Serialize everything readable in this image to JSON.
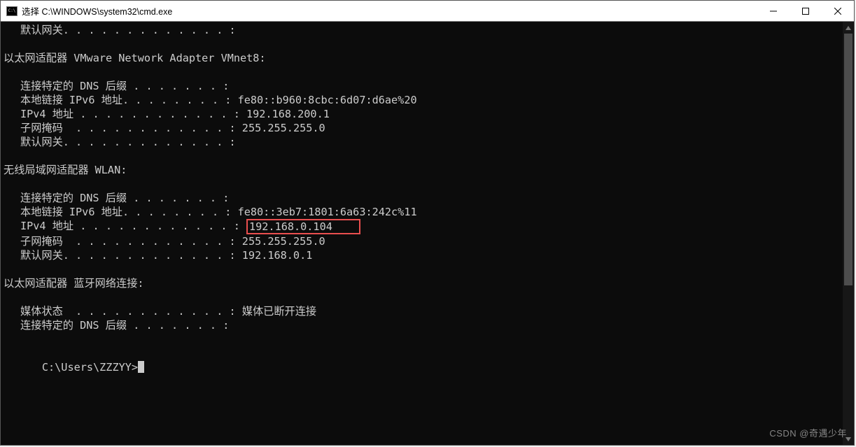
{
  "window": {
    "title": "选择 C:\\WINDOWS\\system32\\cmd.exe"
  },
  "term": {
    "top_line": {
      "label": "默认网关",
      "dots": ". . . . . . . . . . . . .",
      "sep": " : ",
      "val": ""
    },
    "adapter_vmnet8_header": "以太网适配器 VMware Network Adapter VMnet8:",
    "vmnet8": {
      "dns_suffix": {
        "label": "连接特定的 DNS 后缀 ",
        "dots": ". . . . . . .",
        "sep": " : ",
        "val": ""
      },
      "ipv6": {
        "label": "本地链接 IPv6 地址",
        "dots": ". . . . . . . .",
        "sep": " : ",
        "val": "fe80::b960:8cbc:6d07:d6ae%20"
      },
      "ipv4": {
        "label": "IPv4 地址 ",
        "dots": ". . . . . . . . . . . .",
        "sep": " : ",
        "val": "192.168.200.1"
      },
      "subnet": {
        "label": "子网掩码  ",
        "dots": ". . . . . . . . . . . .",
        "sep": " : ",
        "val": "255.255.255.0"
      },
      "gateway": {
        "label": "默认网关",
        "dots": ". . . . . . . . . . . . .",
        "sep": " : ",
        "val": ""
      }
    },
    "adapter_wlan_header": "无线局域网适配器 WLAN:",
    "wlan": {
      "dns_suffix": {
        "label": "连接特定的 DNS 后缀 ",
        "dots": ". . . . . . .",
        "sep": " : ",
        "val": ""
      },
      "ipv6": {
        "label": "本地链接 IPv6 地址",
        "dots": ". . . . . . . .",
        "sep": " : ",
        "val": "fe80::3eb7:1801:6a63:242c%11"
      },
      "ipv4": {
        "label": "IPv4 地址 ",
        "dots": ". . . . . . . . . . . .",
        "sep": " : ",
        "val": "192.168.0.104"
      },
      "subnet": {
        "label": "子网掩码  ",
        "dots": ". . . . . . . . . . . .",
        "sep": " : ",
        "val": "255.255.255.0"
      },
      "gateway": {
        "label": "默认网关",
        "dots": ". . . . . . . . . . . . .",
        "sep": " : ",
        "val": "192.168.0.1"
      }
    },
    "adapter_bt_header": "以太网适配器 蓝牙网络连接:",
    "bt": {
      "media": {
        "label": "媒体状态  ",
        "dots": ". . . . . . . . . . . .",
        "sep": " : ",
        "val": "媒体已断开连接"
      },
      "dns_suffix": {
        "label": "连接特定的 DNS 后缀 ",
        "dots": ". . . . . . .",
        "sep": " : ",
        "val": ""
      }
    },
    "prompt": "C:\\Users\\ZZZYY>"
  },
  "watermark": "CSDN @奇遇少年"
}
